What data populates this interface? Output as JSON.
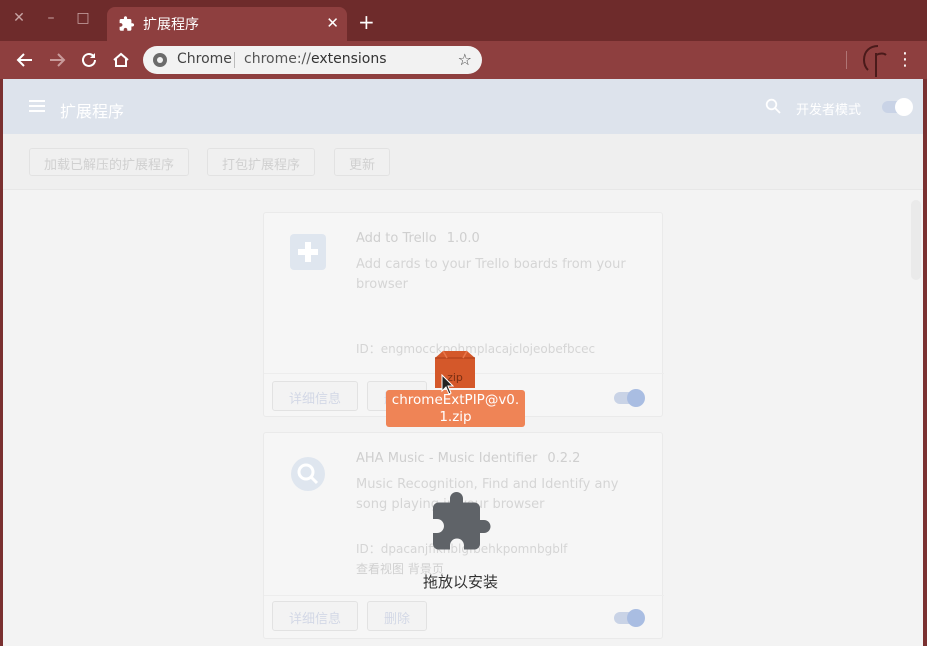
{
  "window": {
    "close_glyph": "✕",
    "minimize_glyph": "–",
    "maximize_glyph": "□"
  },
  "tab": {
    "title": "扩展程序",
    "close_glyph": "✕",
    "icon": "puzzle-icon"
  },
  "new_tab_glyph": "+",
  "omnibox": {
    "chip_label": "Chrome",
    "url_scheme": "chrome://",
    "url_path": "extensions"
  },
  "header": {
    "title": "扩展程序",
    "dev_mode_label": "开发者模式",
    "dev_mode_on": true
  },
  "actions": {
    "load_unpacked": "加载已解压的扩展程序",
    "pack": "打包扩展程序",
    "update": "更新"
  },
  "extensions": [
    {
      "name": "Add to Trello",
      "version": "1.0.0",
      "description": "Add cards to your Trello boards from your browser",
      "id_label": "ID：",
      "id": "engmocckpohmplacajclojeobefbcec",
      "details_label": "详细信息",
      "remove_label": "删除",
      "enabled": true
    },
    {
      "name": "AHA Music - Music Identifier",
      "version": "0.2.2",
      "description": "Music Recognition, Find and Identify any song playing in your browser",
      "id_label": "ID：",
      "id": "dpacanjfikhblgfbehkpomnbgblf",
      "view_label": "查看视图",
      "view_link": "背景页",
      "details_label": "详细信息",
      "remove_label": "删除",
      "enabled": true
    }
  ],
  "drag": {
    "file_ext": "zip",
    "file_name_line1": "chromeExtPIP@v0.",
    "file_name_line2": "1.zip"
  },
  "drop": {
    "text": "拖放以安装"
  },
  "colors": {
    "frame": "#6e2b2b",
    "tab_active": "#8e3f3f",
    "drag_label": "#ef8456",
    "header_bg": "#dde3ec"
  }
}
